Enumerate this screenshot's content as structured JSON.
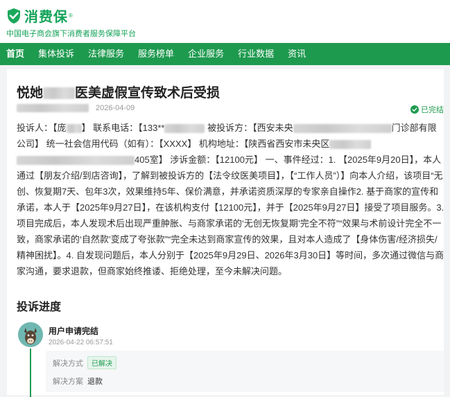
{
  "brand": {
    "name": "消费保",
    "reg_mark": "®",
    "slogan": "中国电子商会旗下消费者服务保障平台",
    "color": "#15a35a"
  },
  "nav": {
    "color": "#1e9a4f",
    "items": [
      {
        "label": "首页",
        "active": true
      },
      {
        "label": "集体投诉"
      },
      {
        "label": "法律服务"
      },
      {
        "label": "服务榜单"
      },
      {
        "label": "企业服务"
      },
      {
        "label": "行业数据"
      },
      {
        "label": "资讯"
      }
    ]
  },
  "complaint": {
    "title_prefix": "悦她",
    "title_suffix": "医美虚假宣传致术后受损",
    "date": "2026-04-09",
    "status": "已完结",
    "body": {
      "seg1": "投诉人：【庞",
      "seg2": "】 联系电话：【133**",
      "seg3": "被投诉方：【西安未央",
      "seg4": "门诊部有限公司】 统一社会信用代码（如有）：【XXXX】 机构地址：【陕西省西安市未央区",
      "seg5": "405室】 涉诉金额：【12100元】 一、事件经过：1. 【2025年9月20日】，本人通过【朋友介绍/到店咨询】，了解到被投诉方的【法令纹医美项目】，【“工作人员”）】向本人介绍，该项目“无创、恢复期7天、包年3次，效果维持5年、保价满意，并承诺资质深厚的专家亲自操作2. 基于商家的宣传和承诺，本人于【2025年9月27日】，在该机构支付【12100元】，并于【2025年9月27日】接受了项目服务。3. 项目完成后，本人发现术后出现严重肿胀、与商家承诺的‘无创无恢复期’完全不符”“效果与术前设计完全不一致，商家承诺的‘自然款’变成了夸张款”“完全未达到商家宣传的效果，且对本人造成了【身体伤害/经济损失/精神困扰】。4. 自发现问题后，本人分别于【2025年9月29日、2026年3月30日】等时间，多次通过微信与商家沟通，要求退款，但商家始终推诿、拒绝处理，至今未解决问题。"
    }
  },
  "progress": {
    "section_title": "投诉进度",
    "step_title": "用户申请完结",
    "step_time": "2026-04-22 06:57:51",
    "method_label": "解决方式",
    "method_value": "已解决",
    "plan_label": "解决方案",
    "plan_value": "退款"
  }
}
